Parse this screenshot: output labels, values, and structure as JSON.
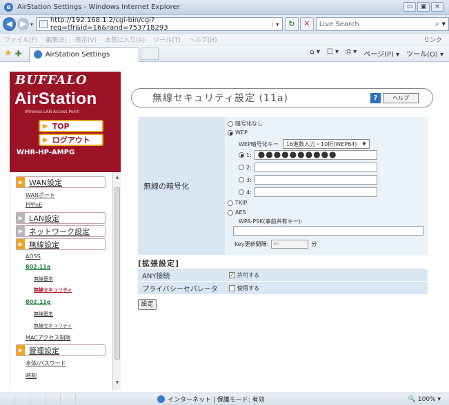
{
  "window": {
    "title": "AirStation Settings - Windows Internet Explorer",
    "controls": [
      "▭",
      "▣",
      "✕"
    ]
  },
  "browser": {
    "url": "http://192.168.1.2/cgi-bin/cgi?req=tfr&id=16&rand=753718293",
    "search_placeholder": "Live Search",
    "menu": [
      "ファイル(F)",
      "編集(E)",
      "表示(V)",
      "お気に入り(A)",
      "ツール(T)",
      "ヘルプ(H)"
    ],
    "links_label": "リンク",
    "tab_title": "AirStation Settings",
    "toolbar": [
      "⌂ ▾",
      "☐ ▾",
      "⎙ ▾",
      "ページ(P) ▾",
      "ツール(O) ▾"
    ]
  },
  "sidebar": {
    "logo_buffalo": "BUFFALO",
    "logo_airstation": "AirStation",
    "logo_tagline": "Wireless LAN Access Point",
    "top_button": "TOP",
    "logout_button": "ログアウト",
    "model": "WHR-HP-AMPG",
    "menu": {
      "wan_header": "WAN設定",
      "wan_port": "WANポート",
      "pppoe": "PPPoE",
      "lan_header": "LAN設定",
      "network_header": "ネットワーク設定",
      "wireless_header": "無線設定",
      "aoss": "AOSS",
      "a11": "802.11a",
      "a11_basic": "無線基本",
      "a11_security": "無線セキュリティ",
      "g11": "802.11g",
      "g11_basic": "無線基本",
      "g11_security": "無線セキュリティ",
      "mac_access": "MACアクセス制限",
      "admin_header": "管理設定",
      "password": "本体/パスワード",
      "clock": "時刻"
    }
  },
  "page": {
    "title": "無線セキュリティ設定 (11a)",
    "help_label": "ヘルプ",
    "encryption_label": "無線の暗号化",
    "options": {
      "none": "暗号化なし",
      "wep": "WEP",
      "tkip": "TKIP",
      "aes": "AES"
    },
    "selected_option": "WEP",
    "wep_key_label": "WEP暗号化キー",
    "wep_key_format": "16進数入力・10桁(WEP64)",
    "keys": [
      {
        "label": "1:",
        "value": "●●●●●●●●●●",
        "selected": true
      },
      {
        "label": "2:",
        "value": "",
        "selected": false
      },
      {
        "label": "3:",
        "value": "",
        "selected": false
      },
      {
        "label": "4:",
        "value": "",
        "selected": false
      }
    ],
    "psk_label": "WPA-PSK(事前共有キー):",
    "key_update_label": "Key更新間隔:",
    "key_update_value": "60",
    "key_update_unit": "分",
    "extended_header": "[拡張設定]",
    "any_label": "ANY接続",
    "any_checkbox": "許可する",
    "any_checked": true,
    "privacy_label": "プライバシーセパレータ",
    "privacy_checkbox": "使用する",
    "privacy_checked": false,
    "submit": "設定"
  },
  "status": {
    "zone": "インターネット | 保護モード: 有効",
    "zoom": "100%"
  }
}
